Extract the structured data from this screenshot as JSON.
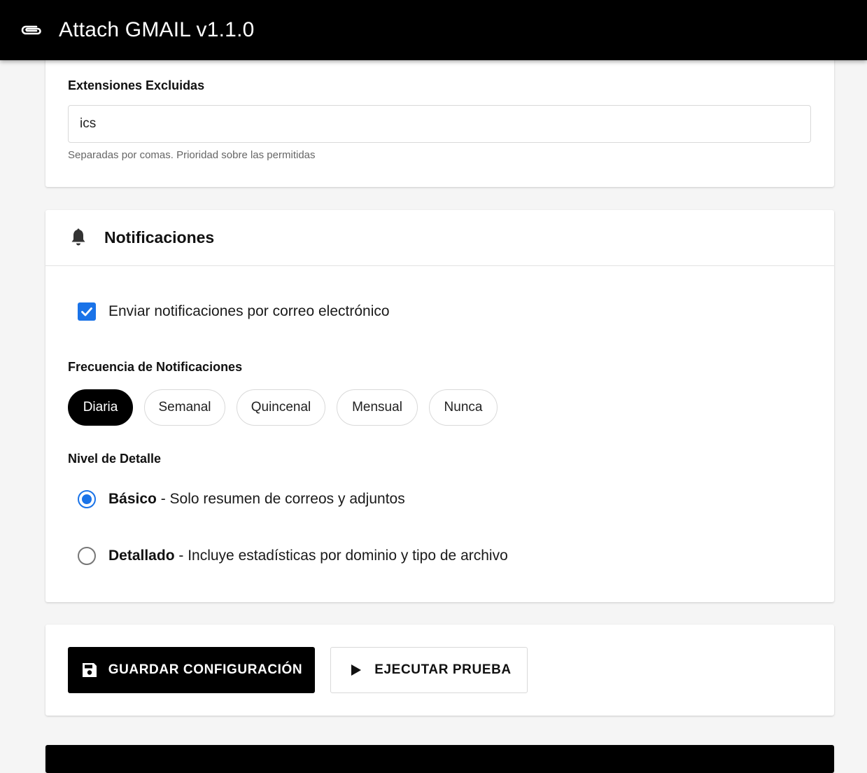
{
  "app": {
    "title": "Attach GMAIL v1.1.0",
    "icon": "paperclip-icon"
  },
  "extensions": {
    "label": "Extensiones Excluidas",
    "value": "ics",
    "helper": "Separadas por comas. Prioridad sobre las permitidas"
  },
  "notifications": {
    "icon": "bell-icon",
    "title": "Notificaciones",
    "email_checkbox": {
      "label": "Enviar notificaciones por correo electrónico",
      "checked": true
    },
    "frequency": {
      "label": "Frecuencia de Notificaciones",
      "options": [
        "Diaria",
        "Semanal",
        "Quincenal",
        "Mensual",
        "Nunca"
      ],
      "selected": "Diaria"
    },
    "detail": {
      "label": "Nivel de Detalle",
      "options": [
        {
          "title": "Básico",
          "description": " - Solo resumen de correos y adjuntos",
          "selected": true
        },
        {
          "title": "Detallado",
          "description": " - Incluye estadísticas por dominio y tipo de archivo",
          "selected": false
        }
      ]
    }
  },
  "actions": {
    "save_label": "GUARDAR CONFIGURACIÓN",
    "save_icon": "save-icon",
    "test_label": "EJECUTAR PRUEBA",
    "test_icon": "play-icon"
  },
  "colors": {
    "primary": "#1a73e8",
    "dark": "#000000",
    "background": "#f5f5f5"
  }
}
